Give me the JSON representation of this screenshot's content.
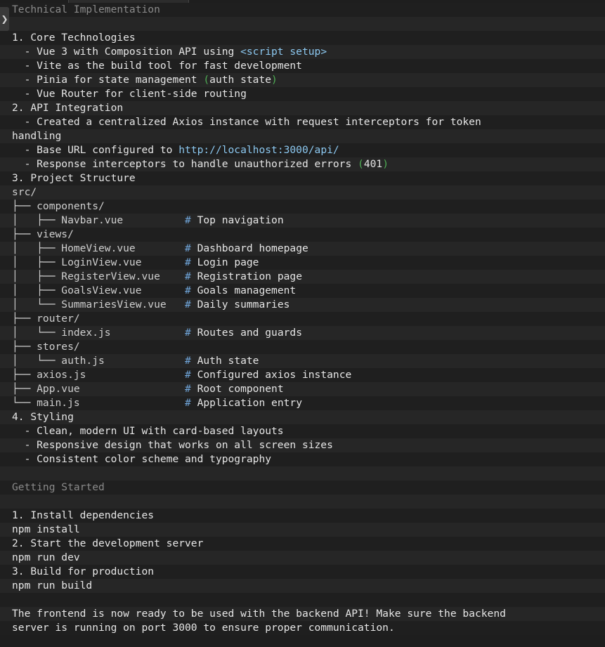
{
  "header": {
    "section_title": "Technical Implementation"
  },
  "side_toggle_icon": "chevron-right-icon",
  "colors": {
    "link": "#8cc8f0",
    "paren": "#4fae55",
    "comment_hash": "#6fa4d8",
    "muted": "#8a8a8a"
  },
  "content": {
    "core_heading": "1. Core Technologies",
    "core_items": [
      {
        "prefix": "  - Vue 3 with Composition API using ",
        "code": "<script setup>"
      },
      {
        "text": "  - Vite as the build tool for fast development"
      },
      {
        "prefix": "  - Pinia for state management ",
        "paren_open": "(",
        "mid": "auth state",
        "paren_close": ")"
      },
      {
        "text": "  - Vue Router for client-side routing"
      }
    ],
    "api_heading": "2. API Integration",
    "api_items": [
      {
        "text": "  - Created a centralized Axios instance with request interceptors for token"
      },
      {
        "text": "handling",
        "nopad": true
      },
      {
        "prefix": "  - Base URL configured to ",
        "link": "http://localhost:3000/api/"
      },
      {
        "prefix": "  - Response interceptors to handle unauthorized errors ",
        "paren_open": "(",
        "mid": "401",
        "paren_close": ")"
      }
    ],
    "structure_heading": "3. Project Structure",
    "tree": [
      {
        "text": "src/"
      },
      {
        "text": "├── components/"
      },
      {
        "text": "│   ├── Navbar.vue",
        "comment": "Top navigation"
      },
      {
        "text": "├── views/"
      },
      {
        "text": "│   ├── HomeView.vue",
        "comment": "Dashboard homepage"
      },
      {
        "text": "│   ├── LoginView.vue",
        "comment": "Login page"
      },
      {
        "text": "│   ├── RegisterView.vue",
        "comment": "Registration page"
      },
      {
        "text": "│   ├── GoalsView.vue",
        "comment": "Goals management"
      },
      {
        "text": "│   └── SummariesView.vue",
        "comment": "Daily summaries"
      },
      {
        "text": "├── router/"
      },
      {
        "text": "│   └── index.js",
        "comment": "Routes and guards"
      },
      {
        "text": "├── stores/"
      },
      {
        "text": "│   └── auth.js",
        "comment": "Auth state"
      },
      {
        "text": "├── axios.js",
        "comment": "Configured axios instance"
      },
      {
        "text": "├── App.vue",
        "comment": "Root component"
      },
      {
        "text": "└── main.js",
        "comment": "Application entry"
      }
    ],
    "styling_heading": "4. Styling",
    "styling_items": [
      "  - Clean, modern UI with card-based layouts",
      "  - Responsive design that works on all screen sizes",
      "  - Consistent color scheme and typography"
    ],
    "getting_started_title": "Getting Started",
    "steps": [
      "1. Install dependencies",
      "npm install",
      "2. Start the development server",
      "npm run dev",
      "3. Build for production",
      "npm run build"
    ],
    "closing": [
      "The frontend is now ready to be used with the backend API! Make sure the backend",
      "server is running on port 3000 to ensure proper communication."
    ]
  }
}
